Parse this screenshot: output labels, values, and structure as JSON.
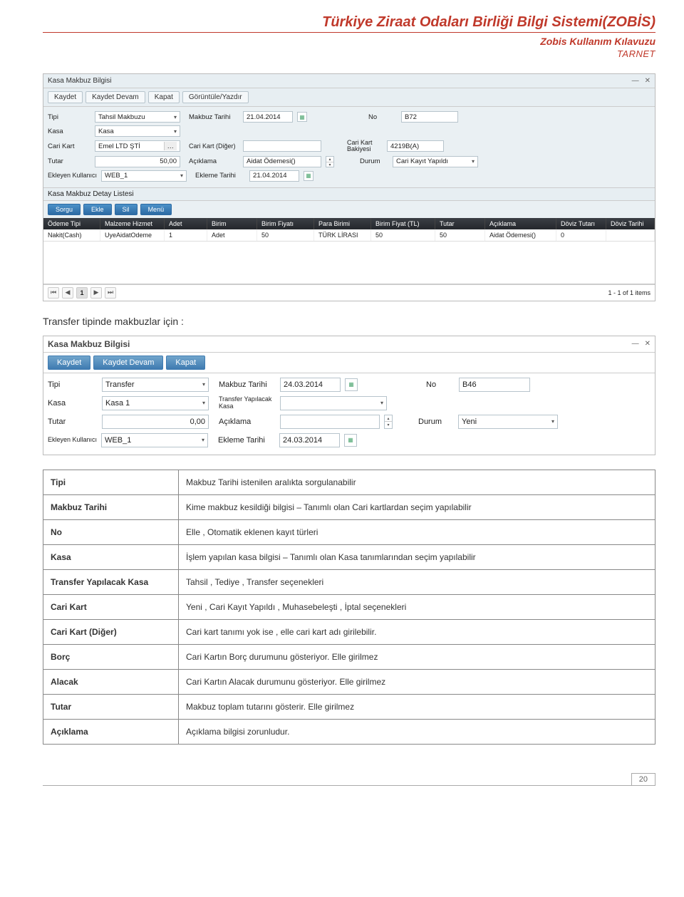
{
  "header": {
    "title": "Türkiye Ziraat Odaları Birliği Bilgi Sistemi(ZOBİS)",
    "subtitle": "Zobis Kullanım Kılavuzu",
    "org": "TARNET"
  },
  "screenshot1": {
    "window_title": "Kasa Makbuz Bilgisi",
    "toolbar": [
      "Kaydet",
      "Kaydet Devam",
      "Kapat",
      "Görüntüle/Yazdır"
    ],
    "fields": {
      "tipi_label": "Tipi",
      "tipi_value": "Tahsil Makbuzu",
      "makbuz_tarihi_label": "Makbuz Tarihi",
      "makbuz_tarihi_value": "21.04.2014",
      "no_label": "No",
      "no_value": "B72",
      "kasa_label": "Kasa",
      "kasa_value": "Kasa",
      "cari_kart_label": "Cari Kart",
      "cari_kart_value": "Emel LTD ŞTİ",
      "cari_kart_diger_label": "Cari Kart (Diğer)",
      "cari_kart_diger_value": "",
      "cari_kart_bakiyesi_label": "Cari Kart Bakiyesi",
      "cari_kart_bakiyesi_value": "4219B(A)",
      "tutar_label": "Tutar",
      "tutar_value": "50,00",
      "aciklama_label": "Açıklama",
      "aciklama_value": "Aidat Ödemesi()",
      "durum_label": "Durum",
      "durum_value": "Cari Kayıt Yapıldı",
      "ekleyen_label": "Ekleyen Kullanıcı",
      "ekleyen_value": "WEB_1",
      "ekleme_tarihi_label": "Ekleme Tarihi",
      "ekleme_tarihi_value": "21.04.2014"
    },
    "list": {
      "panel_title": "Kasa Makbuz Detay Listesi",
      "buttons": [
        "Sorgu",
        "Ekle",
        "Sil",
        "Menü"
      ],
      "columns": [
        "Ödeme Tipi",
        "Malzeme Hizmet",
        "Adet",
        "Birim",
        "Birim Fiyatı",
        "Para Birimi",
        "Birim Fiyat (TL)",
        "Tutar",
        "Açıklama",
        "Döviz Tutarı",
        "Döviz Tarihi"
      ],
      "row": [
        "Nakit(Cash)",
        "UyeAidatOdeme",
        "1",
        "Adet",
        "50",
        "TÜRK LİRASI",
        "50",
        "50",
        "Aidat Ödemesi()",
        "0",
        ""
      ],
      "pager_info": "1 - 1 of 1 items",
      "pager_page": "1"
    }
  },
  "caption": "Transfer tipinde makbuzlar için :",
  "screenshot2": {
    "window_title": "Kasa Makbuz Bilgisi",
    "toolbar": [
      "Kaydet",
      "Kaydet Devam",
      "Kapat"
    ],
    "fields": {
      "tipi_label": "Tipi",
      "tipi_value": "Transfer",
      "makbuz_tarihi_label": "Makbuz Tarihi",
      "makbuz_tarihi_value": "24.03.2014",
      "no_label": "No",
      "no_value": "B46",
      "kasa_label": "Kasa",
      "kasa_value": "Kasa 1",
      "transfer_kasa_label": "Transfer Yapılacak Kasa",
      "transfer_kasa_value": "",
      "tutar_label": "Tutar",
      "tutar_value": "0,00",
      "aciklama_label": "Açıklama",
      "aciklama_value": "",
      "durum_label": "Durum",
      "durum_value": "Yeni",
      "ekleyen_label": "Ekleyen Kullanıcı",
      "ekleyen_value": "WEB_1",
      "ekleme_tarihi_label": "Ekleme Tarihi",
      "ekleme_tarihi_value": "24.03.2014"
    }
  },
  "desc_table": [
    {
      "k": "Tipi",
      "v": "Makbuz Tarihi istenilen aralıkta sorgulanabilir"
    },
    {
      "k": "Makbuz Tarihi",
      "v": "Kime makbuz kesildiği bilgisi – Tanımlı olan Cari kartlardan seçim yapılabilir"
    },
    {
      "k": "No",
      "v": "Elle , Otomatik eklenen kayıt türleri"
    },
    {
      "k": "Kasa",
      "v": "İşlem yapılan kasa bilgisi – Tanımlı olan Kasa tanımlarından seçim yapılabilir"
    },
    {
      "k": "Transfer Yapılacak Kasa",
      "v": "Tahsil , Tediye , Transfer seçenekleri"
    },
    {
      "k": "Cari Kart",
      "v": "Yeni , Cari Kayıt Yapıldı , Muhasebeleşti , İptal seçenekleri"
    },
    {
      "k": "Cari Kart (Diğer)",
      "v": "Cari  kart tanımı yok ise , elle cari kart adı girilebilir."
    },
    {
      "k": "Borç",
      "v": "Cari Kartın Borç durumunu gösteriyor. Elle girilmez"
    },
    {
      "k": "Alacak",
      "v": "Cari Kartın Alacak durumunu gösteriyor. Elle girilmez"
    },
    {
      "k": "Tutar",
      "v": "Makbuz toplam tutarını gösterir. Elle girilmez"
    },
    {
      "k": "Açıklama",
      "v": "Açıklama bilgisi zorunludur."
    }
  ],
  "page_number": "20"
}
